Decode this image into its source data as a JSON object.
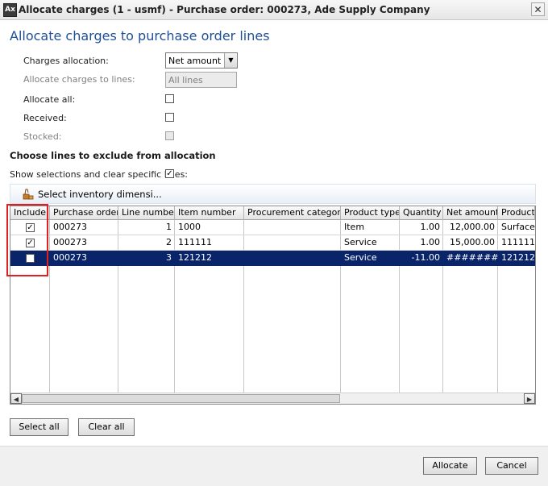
{
  "window": {
    "title": "Allocate charges (1 - usmf) - Purchase order: 000273, Ade Supply Company"
  },
  "heading": "Allocate charges to purchase order lines",
  "form": {
    "charges_allocation_label": "Charges allocation:",
    "charges_allocation_value": "Net amount",
    "allocate_to_lines_label": "Allocate charges to lines:",
    "allocate_to_lines_value": "All lines",
    "allocate_all_label": "Allocate all:",
    "received_label": "Received:",
    "stocked_label": "Stocked:"
  },
  "exclude": {
    "title": "Choose lines to exclude from allocation",
    "show_selections_label": "Show selections and clear specific lines:"
  },
  "toolbar": {
    "select_dims_label": "Select inventory dimensi..."
  },
  "grid": {
    "columns": [
      "Include",
      "Purchase order",
      "Line number",
      "Item number",
      "Procurement category",
      "Product type",
      "Quantity",
      "Net amount",
      "Product n"
    ],
    "rows": [
      {
        "include": true,
        "purchase_order": "000273",
        "line_number": "1",
        "item_number": "1000",
        "procurement_category": "",
        "product_type": "Item",
        "quantity": "1.00",
        "net_amount": "12,000.00",
        "product_name": "Surface l"
      },
      {
        "include": true,
        "purchase_order": "000273",
        "line_number": "2",
        "item_number": "111111",
        "procurement_category": "",
        "product_type": "Service",
        "quantity": "1.00",
        "net_amount": "15,000.00",
        "product_name": "111111"
      },
      {
        "include": false,
        "purchase_order": "000273",
        "line_number": "3",
        "item_number": "121212",
        "procurement_category": "",
        "product_type": "Service",
        "quantity": "-11.00",
        "net_amount": "#######",
        "product_name": "121212"
      }
    ]
  },
  "buttons": {
    "select_all": "Select all",
    "clear_all": "Clear all",
    "allocate": "Allocate",
    "cancel": "Cancel"
  },
  "colors": {
    "heading": "#1f4e99",
    "selected_row": "#0a246a",
    "highlight_box": "#e02020"
  }
}
